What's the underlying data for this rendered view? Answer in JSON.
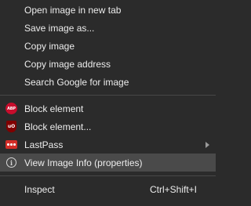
{
  "context_menu": {
    "items": [
      {
        "label": "Open image in new tab"
      },
      {
        "label": "Save image as..."
      },
      {
        "label": "Copy image"
      },
      {
        "label": "Copy image address"
      },
      {
        "label": "Search Google for image"
      },
      {
        "label": "Block element",
        "icon": "adblock-plus-icon",
        "icon_text": "ABP"
      },
      {
        "label": "Block element...",
        "icon": "ublock-origin-icon",
        "icon_text": "uO"
      },
      {
        "label": "LastPass",
        "icon": "lastpass-icon",
        "has_submenu": true
      },
      {
        "label": "View Image Info (properties)",
        "icon": "info-icon",
        "icon_text": "i",
        "highlighted": true
      },
      {
        "label": "Inspect",
        "shortcut": "Ctrl+Shift+I"
      }
    ]
  },
  "colors": {
    "menu_background": "#2b2b2b",
    "highlight_background": "#4a4a4a",
    "separator": "#474747",
    "text": "#ececec",
    "abp_red": "#c70d2c",
    "ublock_red": "#800000",
    "lastpass_red": "#d32d27"
  }
}
